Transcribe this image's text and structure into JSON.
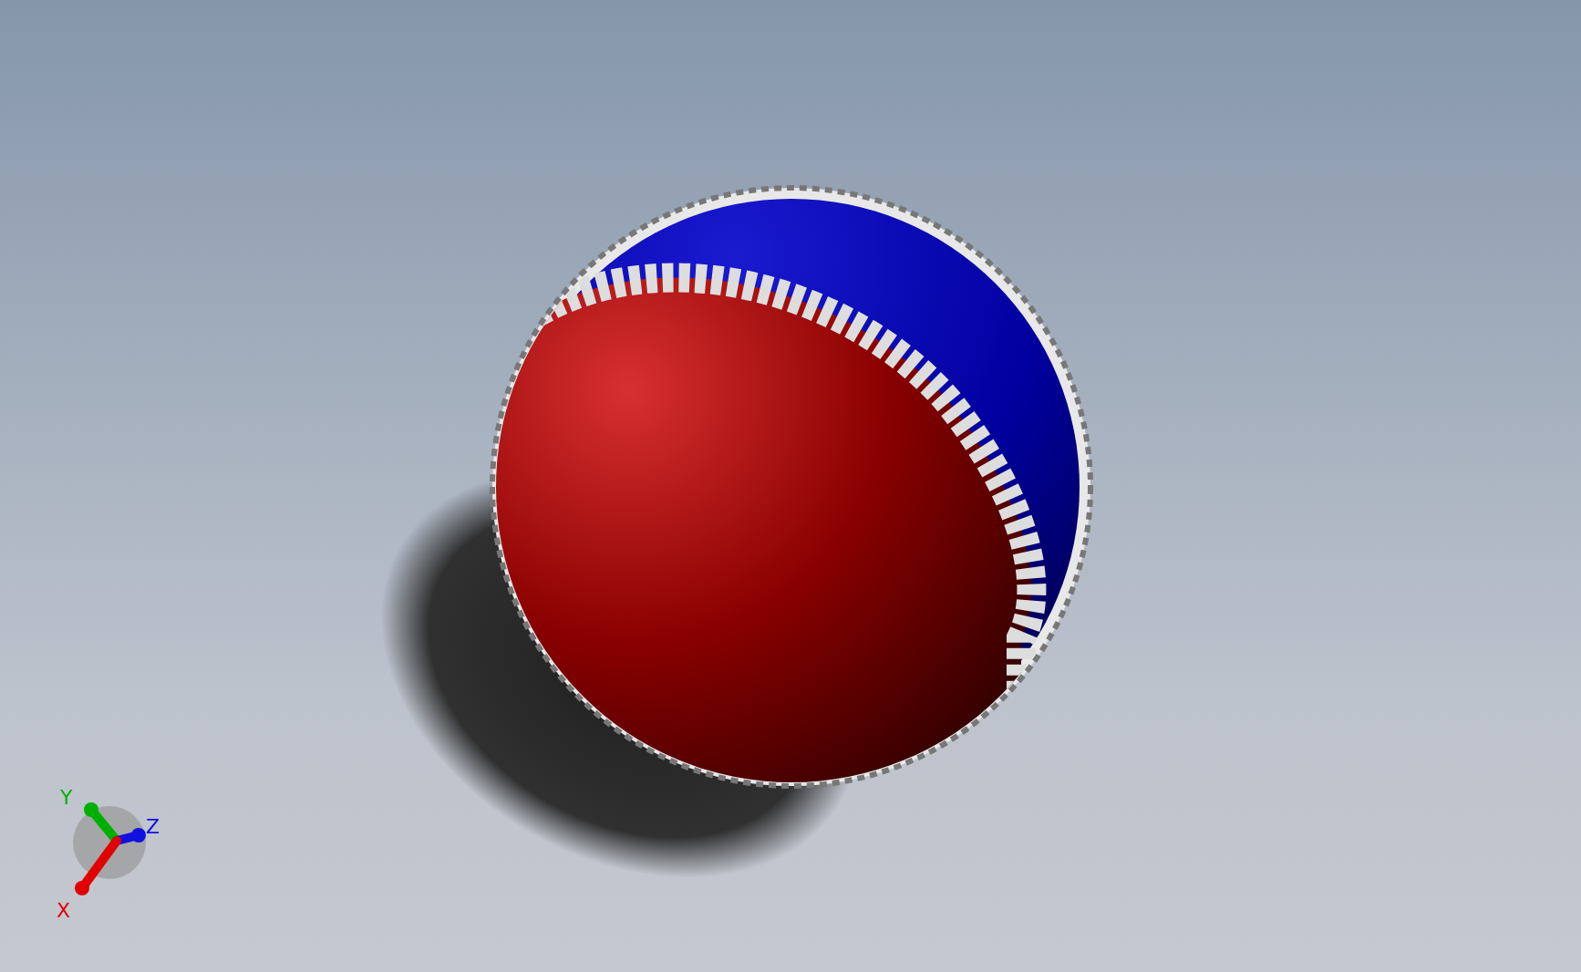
{
  "viewport": {
    "triad": {
      "axes": [
        {
          "label": "Y",
          "color": "#00b000"
        },
        {
          "label": "Z",
          "color": "#1010e0"
        },
        {
          "label": "X",
          "color": "#e00000"
        }
      ]
    }
  }
}
